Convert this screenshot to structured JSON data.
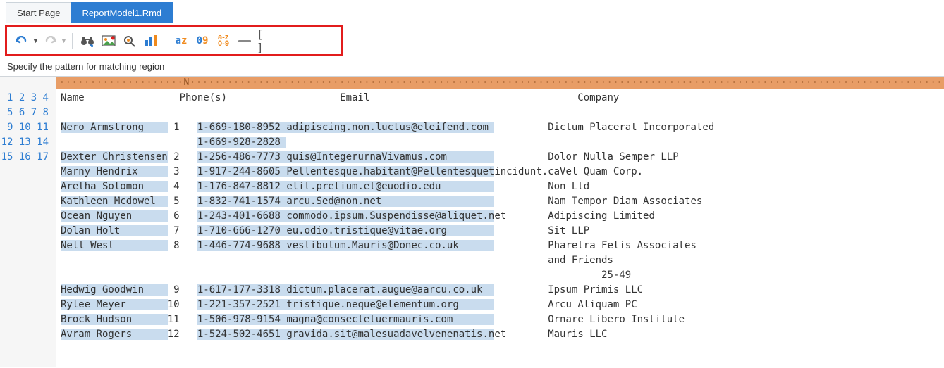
{
  "tabs": {
    "start": "Start Page",
    "file": "ReportModel1.Rmd"
  },
  "hint": "Specify the pattern for matching region",
  "ruler_marker": "Ñ",
  "toolbar": {
    "undo": "undo",
    "redo": "redo",
    "find_replace": "find-replace",
    "image": "image-field",
    "zoom": "zoom-field",
    "bars": "bars-field",
    "az": "a",
    "z": "z",
    "o": "0",
    "nine": "9",
    "range": "a-z\n0-9",
    "blank": "blank",
    "brackets": "[ ]"
  },
  "headers": {
    "name": "Name",
    "phone": "Phone(s)",
    "email": "Email",
    "company": "Company"
  },
  "rows": [
    {
      "ln": 3,
      "name": "Nero Armstrong",
      "idx": "1",
      "phone": "1-669-180-8952",
      "email": "adipiscing.non.luctus@eleifend.com",
      "emailTrail": "",
      "company": "Dictum Placerat Incorporated"
    },
    {
      "ln": 4,
      "name": "",
      "idx": "",
      "phone": "1-669-928-2828",
      "email": "",
      "emailTrail": "",
      "company": ""
    },
    {
      "ln": 5,
      "name": "Dexter Christensen",
      "idx": "2",
      "phone": "1-256-486-7773",
      "email": "quis@IntegerurnaVivamus.com",
      "emailTrail": "",
      "company": "Dolor Nulla Semper LLP"
    },
    {
      "ln": 6,
      "name": "Marny Hendrix",
      "idx": "3",
      "phone": "1-917-244-8605",
      "email": "Pellentesque.habitant@Pellentesquet",
      "emailTrail": "incidunt.ca",
      "company": "Vel Quam Corp."
    },
    {
      "ln": 7,
      "name": "Aretha Solomon",
      "idx": "4",
      "phone": "1-176-847-8812",
      "email": "elit.pretium.et@euodio.edu",
      "emailTrail": "",
      "company": "Non Ltd"
    },
    {
      "ln": 8,
      "name": "Kathleen Mcdowel",
      "idx": "5",
      "phone": "1-832-741-1574",
      "email": "arcu.Sed@non.net",
      "emailTrail": "",
      "company": "Nam Tempor Diam Associates"
    },
    {
      "ln": 9,
      "name": "Ocean Nguyen",
      "idx": "6",
      "phone": "1-243-401-6688",
      "email": "commodo.ipsum.Suspendisse@aliquet.n",
      "emailTrail": "et",
      "company": "Adipiscing Limited"
    },
    {
      "ln": 10,
      "name": "Dolan Holt",
      "idx": "7",
      "phone": "1-710-666-1270",
      "email": "eu.odio.tristique@vitae.org",
      "emailTrail": "",
      "company": "Sit LLP"
    },
    {
      "ln": 11,
      "name": "Nell West",
      "idx": "8",
      "phone": "1-446-774-9688",
      "email": "vestibulum.Mauris@Donec.co.uk",
      "emailTrail": "",
      "company": "Pharetra Felis Associates"
    },
    {
      "ln": 12,
      "name": "",
      "idx": "",
      "phone": "",
      "email": "",
      "emailTrail": "",
      "company": "and Friends"
    },
    {
      "ln": 13,
      "name": "",
      "idx": "",
      "phone": "",
      "email": "",
      "emailTrail": "",
      "company": "         25-49"
    },
    {
      "ln": 14,
      "name": "Hedwig Goodwin",
      "idx": "9",
      "phone": "1-617-177-3318",
      "email": "dictum.placerat.augue@aarcu.co.uk",
      "emailTrail": "",
      "company": "Ipsum Primis LLC"
    },
    {
      "ln": 15,
      "name": "Rylee Meyer",
      "idx": "10",
      "phone": "1-221-357-2521",
      "email": "tristique.neque@elementum.org",
      "emailTrail": "",
      "company": "Arcu Aliquam PC"
    },
    {
      "ln": 16,
      "name": "Brock Hudson",
      "idx": "11",
      "phone": "1-506-978-9154",
      "email": "magna@consectetuermauris.com",
      "emailTrail": "",
      "company": "Ornare Libero Institute"
    },
    {
      "ln": 17,
      "name": "Avram Rogers",
      "idx": "12",
      "phone": "1-524-502-4651",
      "email": "gravida.sit@malesuadavelvenenatis.n",
      "emailTrail": "et",
      "company": "Mauris LLC"
    }
  ],
  "layout": {
    "nameW": 20,
    "idxW": 5,
    "phoneW": 15,
    "emailW": 44
  }
}
